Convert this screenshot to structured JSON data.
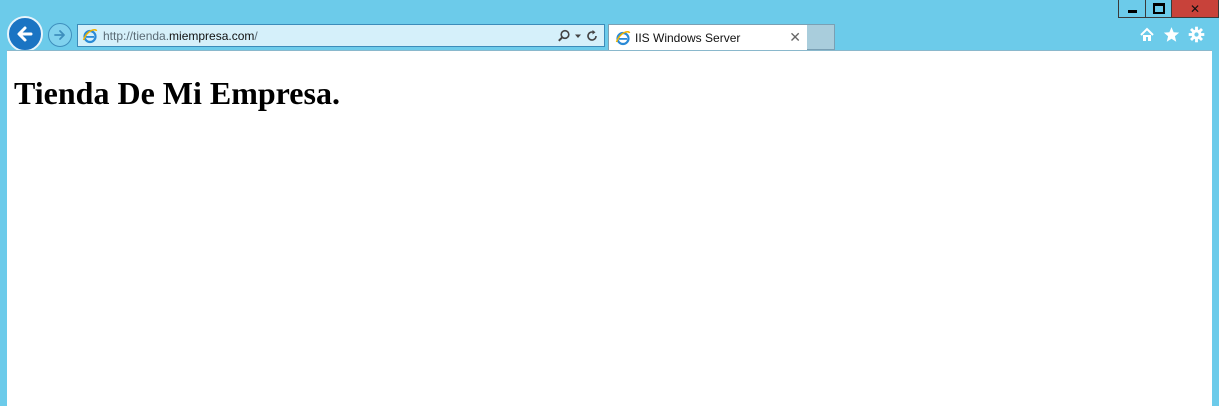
{
  "window": {
    "minimize_icon": "minimize-icon",
    "maximize_icon": "maximize-icon",
    "close_glyph": "✕"
  },
  "nav": {
    "back_icon": "back-arrow-icon",
    "forward_icon": "forward-arrow-icon"
  },
  "address": {
    "url_prefix": "http://tienda.",
    "url_host": "miempresa.com",
    "url_suffix": "/",
    "search_icon": "search-icon",
    "dropdown_icon": "dropdown-icon",
    "refresh_icon": "refresh-icon"
  },
  "tab": {
    "title": "IIS Windows Server",
    "close": "✕"
  },
  "toolbar": {
    "home_icon": "home-icon",
    "favorites_icon": "star-icon",
    "settings_icon": "gear-icon"
  },
  "page": {
    "heading": "Tienda De Mi Empresa."
  },
  "colors": {
    "frame": "#6ccbea",
    "accent": "#1a74c3",
    "close": "#c8423a"
  }
}
